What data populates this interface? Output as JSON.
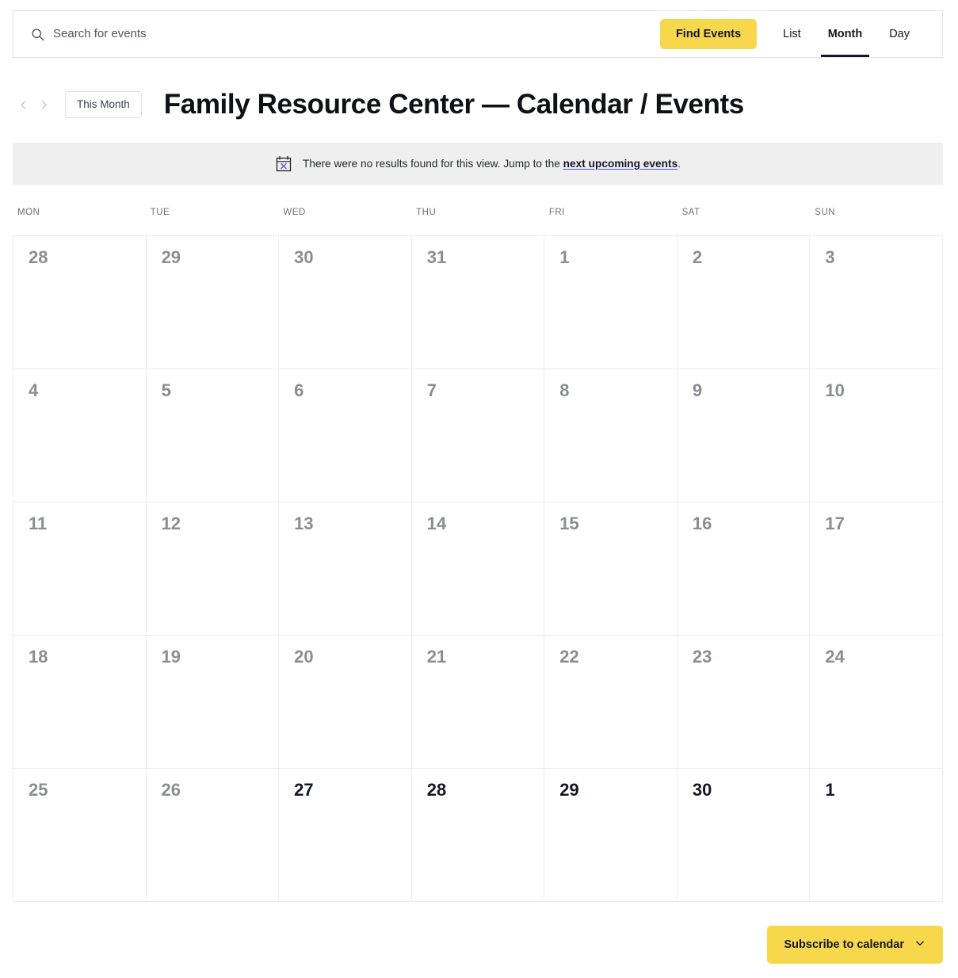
{
  "search": {
    "placeholder": "Search for events",
    "value": "",
    "icon": "search-icon"
  },
  "toolbar": {
    "find_events_label": "Find Events",
    "tabs": [
      {
        "label": "List",
        "active": false
      },
      {
        "label": "Month",
        "active": true
      },
      {
        "label": "Day",
        "active": false
      }
    ]
  },
  "nav": {
    "prev_icon": "chevron-left-icon",
    "next_icon": "chevron-right-icon",
    "this_month_label": "This Month"
  },
  "header": {
    "title": "Family Resource Center — Calendar / Events"
  },
  "notice": {
    "icon": "calendar-x-icon",
    "text_before": "There were no results found for this view. Jump to the ",
    "link_label": "next upcoming events",
    "text_after": "."
  },
  "calendar": {
    "weekdays": [
      "MON",
      "TUE",
      "WED",
      "THU",
      "FRI",
      "SAT",
      "SUN"
    ],
    "weeks": [
      [
        {
          "day": "28",
          "current_month": false
        },
        {
          "day": "29",
          "current_month": false
        },
        {
          "day": "30",
          "current_month": false
        },
        {
          "day": "31",
          "current_month": false
        },
        {
          "day": "1",
          "current_month": false
        },
        {
          "day": "2",
          "current_month": false
        },
        {
          "day": "3",
          "current_month": false
        }
      ],
      [
        {
          "day": "4",
          "current_month": false
        },
        {
          "day": "5",
          "current_month": false
        },
        {
          "day": "6",
          "current_month": false
        },
        {
          "day": "7",
          "current_month": false
        },
        {
          "day": "8",
          "current_month": false
        },
        {
          "day": "9",
          "current_month": false
        },
        {
          "day": "10",
          "current_month": false
        }
      ],
      [
        {
          "day": "11",
          "current_month": false
        },
        {
          "day": "12",
          "current_month": false
        },
        {
          "day": "13",
          "current_month": false
        },
        {
          "day": "14",
          "current_month": false
        },
        {
          "day": "15",
          "current_month": false
        },
        {
          "day": "16",
          "current_month": false
        },
        {
          "day": "17",
          "current_month": false
        }
      ],
      [
        {
          "day": "18",
          "current_month": false
        },
        {
          "day": "19",
          "current_month": false
        },
        {
          "day": "20",
          "current_month": false
        },
        {
          "day": "21",
          "current_month": false
        },
        {
          "day": "22",
          "current_month": false
        },
        {
          "day": "23",
          "current_month": false
        },
        {
          "day": "24",
          "current_month": false
        }
      ],
      [
        {
          "day": "25",
          "current_month": false
        },
        {
          "day": "26",
          "current_month": false
        },
        {
          "day": "27",
          "current_month": true
        },
        {
          "day": "28",
          "current_month": true
        },
        {
          "day": "29",
          "current_month": true
        },
        {
          "day": "30",
          "current_month": true
        },
        {
          "day": "1",
          "current_month": true
        }
      ]
    ]
  },
  "footer": {
    "subscribe_label": "Subscribe to calendar",
    "subscribe_icon": "chevron-down-icon"
  },
  "colors": {
    "accent_yellow": "#f7d84c",
    "notice_bg": "#efefef",
    "grid_line": "#ededed",
    "muted_day": "#8b8d94",
    "link_underline": "#4b4ddb"
  }
}
